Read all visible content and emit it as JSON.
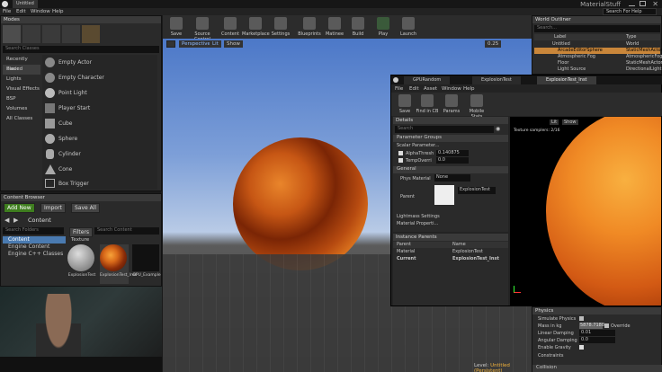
{
  "window": {
    "title": "Untitled",
    "project": "MaterialStuff",
    "search_help": "Search For Help"
  },
  "menu": [
    "File",
    "Edit",
    "Window",
    "Help"
  ],
  "modes": {
    "title": "Modes",
    "search_placeholder": "Search Classes"
  },
  "categories": [
    "Recently Placed",
    "Basic",
    "Lights",
    "Visual Effects",
    "BSP",
    "Volumes",
    "All Classes"
  ],
  "place_items": [
    "Empty Actor",
    "Empty Character",
    "Point Light",
    "Player Start",
    "Cube",
    "Sphere",
    "Cylinder",
    "Cone",
    "Box Trigger"
  ],
  "toolbar": [
    "Save",
    "Source Control",
    "Content",
    "Marketplace",
    "Settings",
    "Blueprints",
    "Matinee",
    "Build",
    "Play",
    "Launch"
  ],
  "viewport": {
    "perspective": "Perspective",
    "lit": "Lit",
    "show": "Show",
    "fov": "0.25",
    "level_label": "Level:",
    "level_name": "Untitled (Persistent)"
  },
  "content_browser": {
    "title": "Content Browser",
    "add_new": "Add New",
    "import": "Import",
    "save_all": "Save All",
    "path": "Content",
    "search_folders": "Search Folders",
    "filters": "Filters",
    "search_placeholder": "Search Content",
    "tree": [
      "Content",
      "Engine Content",
      "Engine C++ Classes"
    ],
    "section": "Texture",
    "assets": [
      "ExplosionTest",
      "ExplosionTest_Inst",
      "GPU_Example"
    ]
  },
  "world_outliner": {
    "title": "World Outliner",
    "search_placeholder": "Search...",
    "col_label": "Label",
    "col_type": "Type",
    "rows": [
      {
        "label": "Untitled",
        "type": "World"
      },
      {
        "label": "ArcadeEditorSphere",
        "type": "StaticMeshActor"
      },
      {
        "label": "Atmospheric Fog",
        "type": "AtmosphericFog"
      },
      {
        "label": "Floor",
        "type": "StaticMeshActor"
      },
      {
        "label": "Light Source",
        "type": "DirectionalLight"
      }
    ]
  },
  "mat_editor": {
    "tabs": [
      "GPURandom",
      "ExplosionTest",
      "ExplosionTest_Inst"
    ],
    "menu": [
      "File",
      "Edit",
      "Asset",
      "Window",
      "Help"
    ],
    "toolbar": [
      "Save",
      "Find in CB",
      "Params",
      "Mobile Stats"
    ],
    "details_title": "Details",
    "search_placeholder": "Search",
    "param_groups": "Parameter Groups",
    "scalar_params": "Scalar Parameter...",
    "params": [
      {
        "name": "AlphaThresh",
        "value": "0.140875"
      },
      {
        "name": "TempOverri",
        "value": "0.0"
      }
    ],
    "general": "General",
    "phys_label": "Phys Material",
    "phys_value": "None",
    "parent_label": "Parent",
    "parent_value": "ExplosionTest",
    "lightmass": "Lightmass Settings",
    "mat_props": "Material Properti...",
    "instance_parents": "Instance Parents",
    "ip_col_parent": "Parent",
    "ip_col_name": "Name",
    "ip_rows": [
      {
        "parent": "Material",
        "name": "ExplosionTest"
      },
      {
        "parent": "Current",
        "name": "ExplosionTest_Inst"
      }
    ],
    "preview_lit": "Lit",
    "preview_show": "Show",
    "preview_stats": "Texture samplers: 2/16"
  },
  "physics": {
    "title": "Physics",
    "rows": [
      {
        "label": "Simulate Physics",
        "value": ""
      },
      {
        "label": "Mass in kg",
        "value": "5878.7188"
      },
      {
        "label": "Linear Damping",
        "value": "0.01"
      },
      {
        "label": "Angular Damping",
        "value": "0.0"
      },
      {
        "label": "Enable Gravity",
        "value": ""
      }
    ],
    "override": "Override",
    "constraints": "Constraints",
    "collision": "Collision"
  }
}
